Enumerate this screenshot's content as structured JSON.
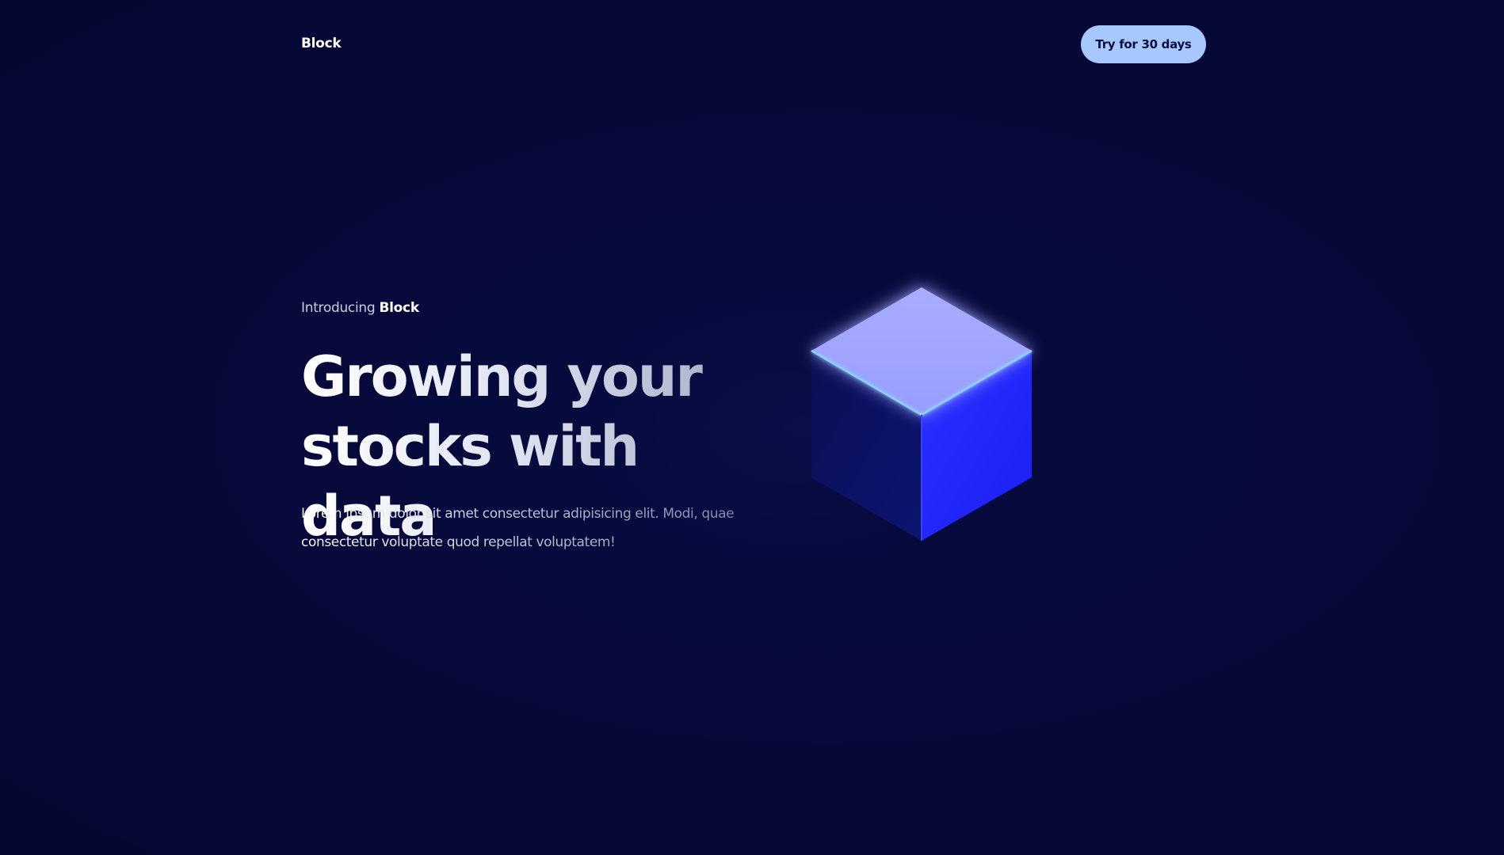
{
  "header": {
    "logo": "Block",
    "cta_label": "Try for 30 days"
  },
  "hero": {
    "intro_prefix": "Introducing ",
    "intro_brand": "Block",
    "headline_line1": "Growing your",
    "headline_line2": "stocks with data",
    "description": "Lorem ipsum dolor sit amet consectetur adipisicing elit. Modi, quae consectetur voluptate quod repellat voluptatem!"
  },
  "colors": {
    "background": "#060939",
    "cta_background": "#a6c8ff",
    "cube_top": "#a1a6ff",
    "cube_left": "#0c1264",
    "cube_right": "#1e24ff",
    "edge_highlight": "#8fd0ff"
  },
  "icons": {
    "hero_graphic": "cube-icon"
  }
}
